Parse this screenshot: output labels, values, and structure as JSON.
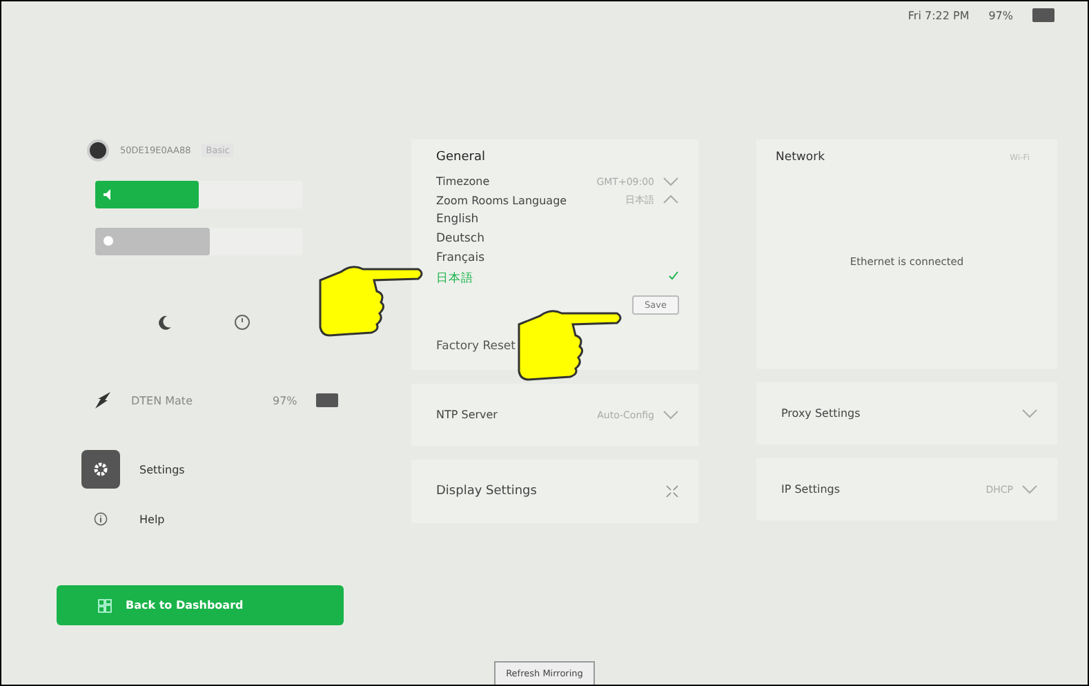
{
  "status_bar": {
    "time": "Fri 7:22 PM",
    "battery": "97%"
  },
  "device": {
    "id": "50DE19E0AA88",
    "badge": "Basic"
  },
  "sliders": [
    {
      "kind": "volume",
      "level": 0.5,
      "disabled": false
    },
    {
      "kind": "brightness",
      "level": 0.55,
      "disabled": true
    }
  ],
  "mate": {
    "name": "DTEN Mate",
    "battery": "97%"
  },
  "sidebar": {
    "items": [
      {
        "kind": "settings",
        "label": "Settings",
        "selected": true
      },
      {
        "kind": "help",
        "label": "Help",
        "selected": false
      }
    ]
  },
  "dashboard_button": "Back to Dashboard",
  "general": {
    "title": "General",
    "timezone": {
      "label": "Timezone",
      "value": "GMT+09:00"
    },
    "language": {
      "label": "Zoom Rooms Language",
      "value": "日本語",
      "expanded": true,
      "options": [
        {
          "label": "English",
          "selected": false
        },
        {
          "label": "Deutsch",
          "selected": false
        },
        {
          "label": "Français",
          "selected": false
        },
        {
          "label": "日本語",
          "selected": true
        }
      ]
    },
    "save": "Save",
    "factory_reset": "Factory Reset"
  },
  "ntp": {
    "label": "NTP Server",
    "value": "Auto-Config"
  },
  "display": {
    "title": "Display Settings"
  },
  "network": {
    "title": "Network",
    "tab": "Wi-Fi",
    "status": "Ethernet is connected"
  },
  "proxy": {
    "label": "Proxy Settings"
  },
  "ip": {
    "label": "IP Settings",
    "value": "DHCP"
  },
  "refresh_button": "Refresh Mirroring"
}
